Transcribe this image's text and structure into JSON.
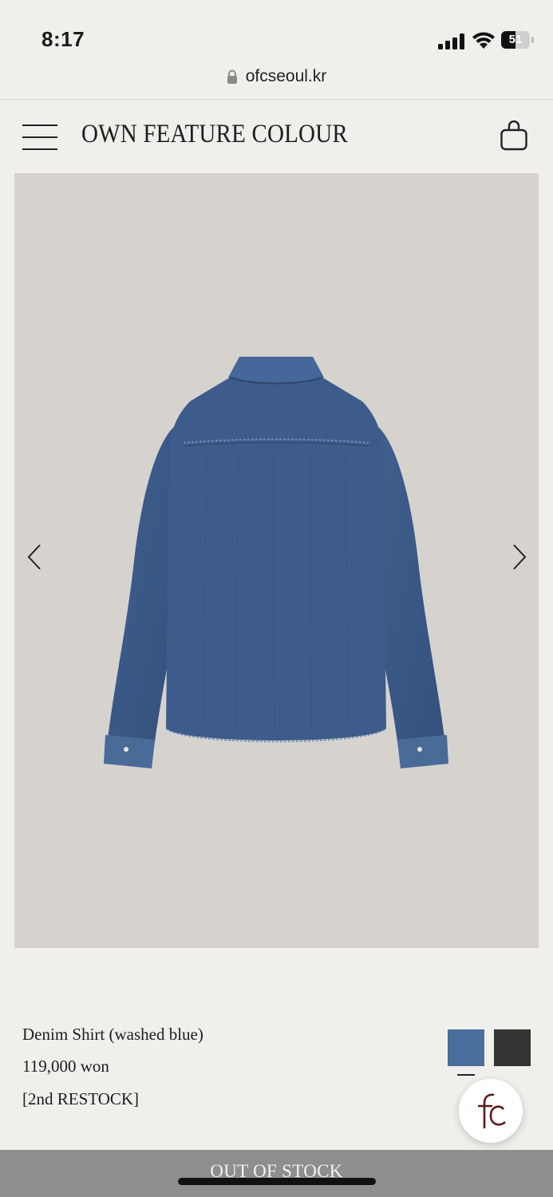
{
  "status_bar": {
    "time": "8:17",
    "battery_level": "51",
    "battery_fraction": 0.51
  },
  "browser": {
    "url": "ofcseoul.kr",
    "lock_icon": "lock-icon"
  },
  "header": {
    "brand": "OWN FEATURE COLOUR",
    "menu_icon": "hamburger-menu-icon",
    "cart_icon": "shopping-bag-icon"
  },
  "product": {
    "name": "Denim Shirt (washed blue)",
    "price": "119,000 won",
    "tag": "[2nd RESTOCK]",
    "image_alt": "denim shirt back view",
    "swatches": [
      {
        "color": "#4a6e9b",
        "selected": true
      },
      {
        "color": "#333333",
        "selected": false
      }
    ]
  },
  "carousel": {
    "prev_icon": "chevron-left-icon",
    "next_icon": "chevron-right-icon"
  },
  "actions": {
    "buy_button_label": "OUT OF STOCK"
  },
  "chat_badge": {
    "logo_text": "fc"
  },
  "colors": {
    "background": "#f1efeb",
    "image_bg": "#d6d3cf",
    "oos_bar": "#8e8e8e",
    "denim": "#3d5a86"
  }
}
